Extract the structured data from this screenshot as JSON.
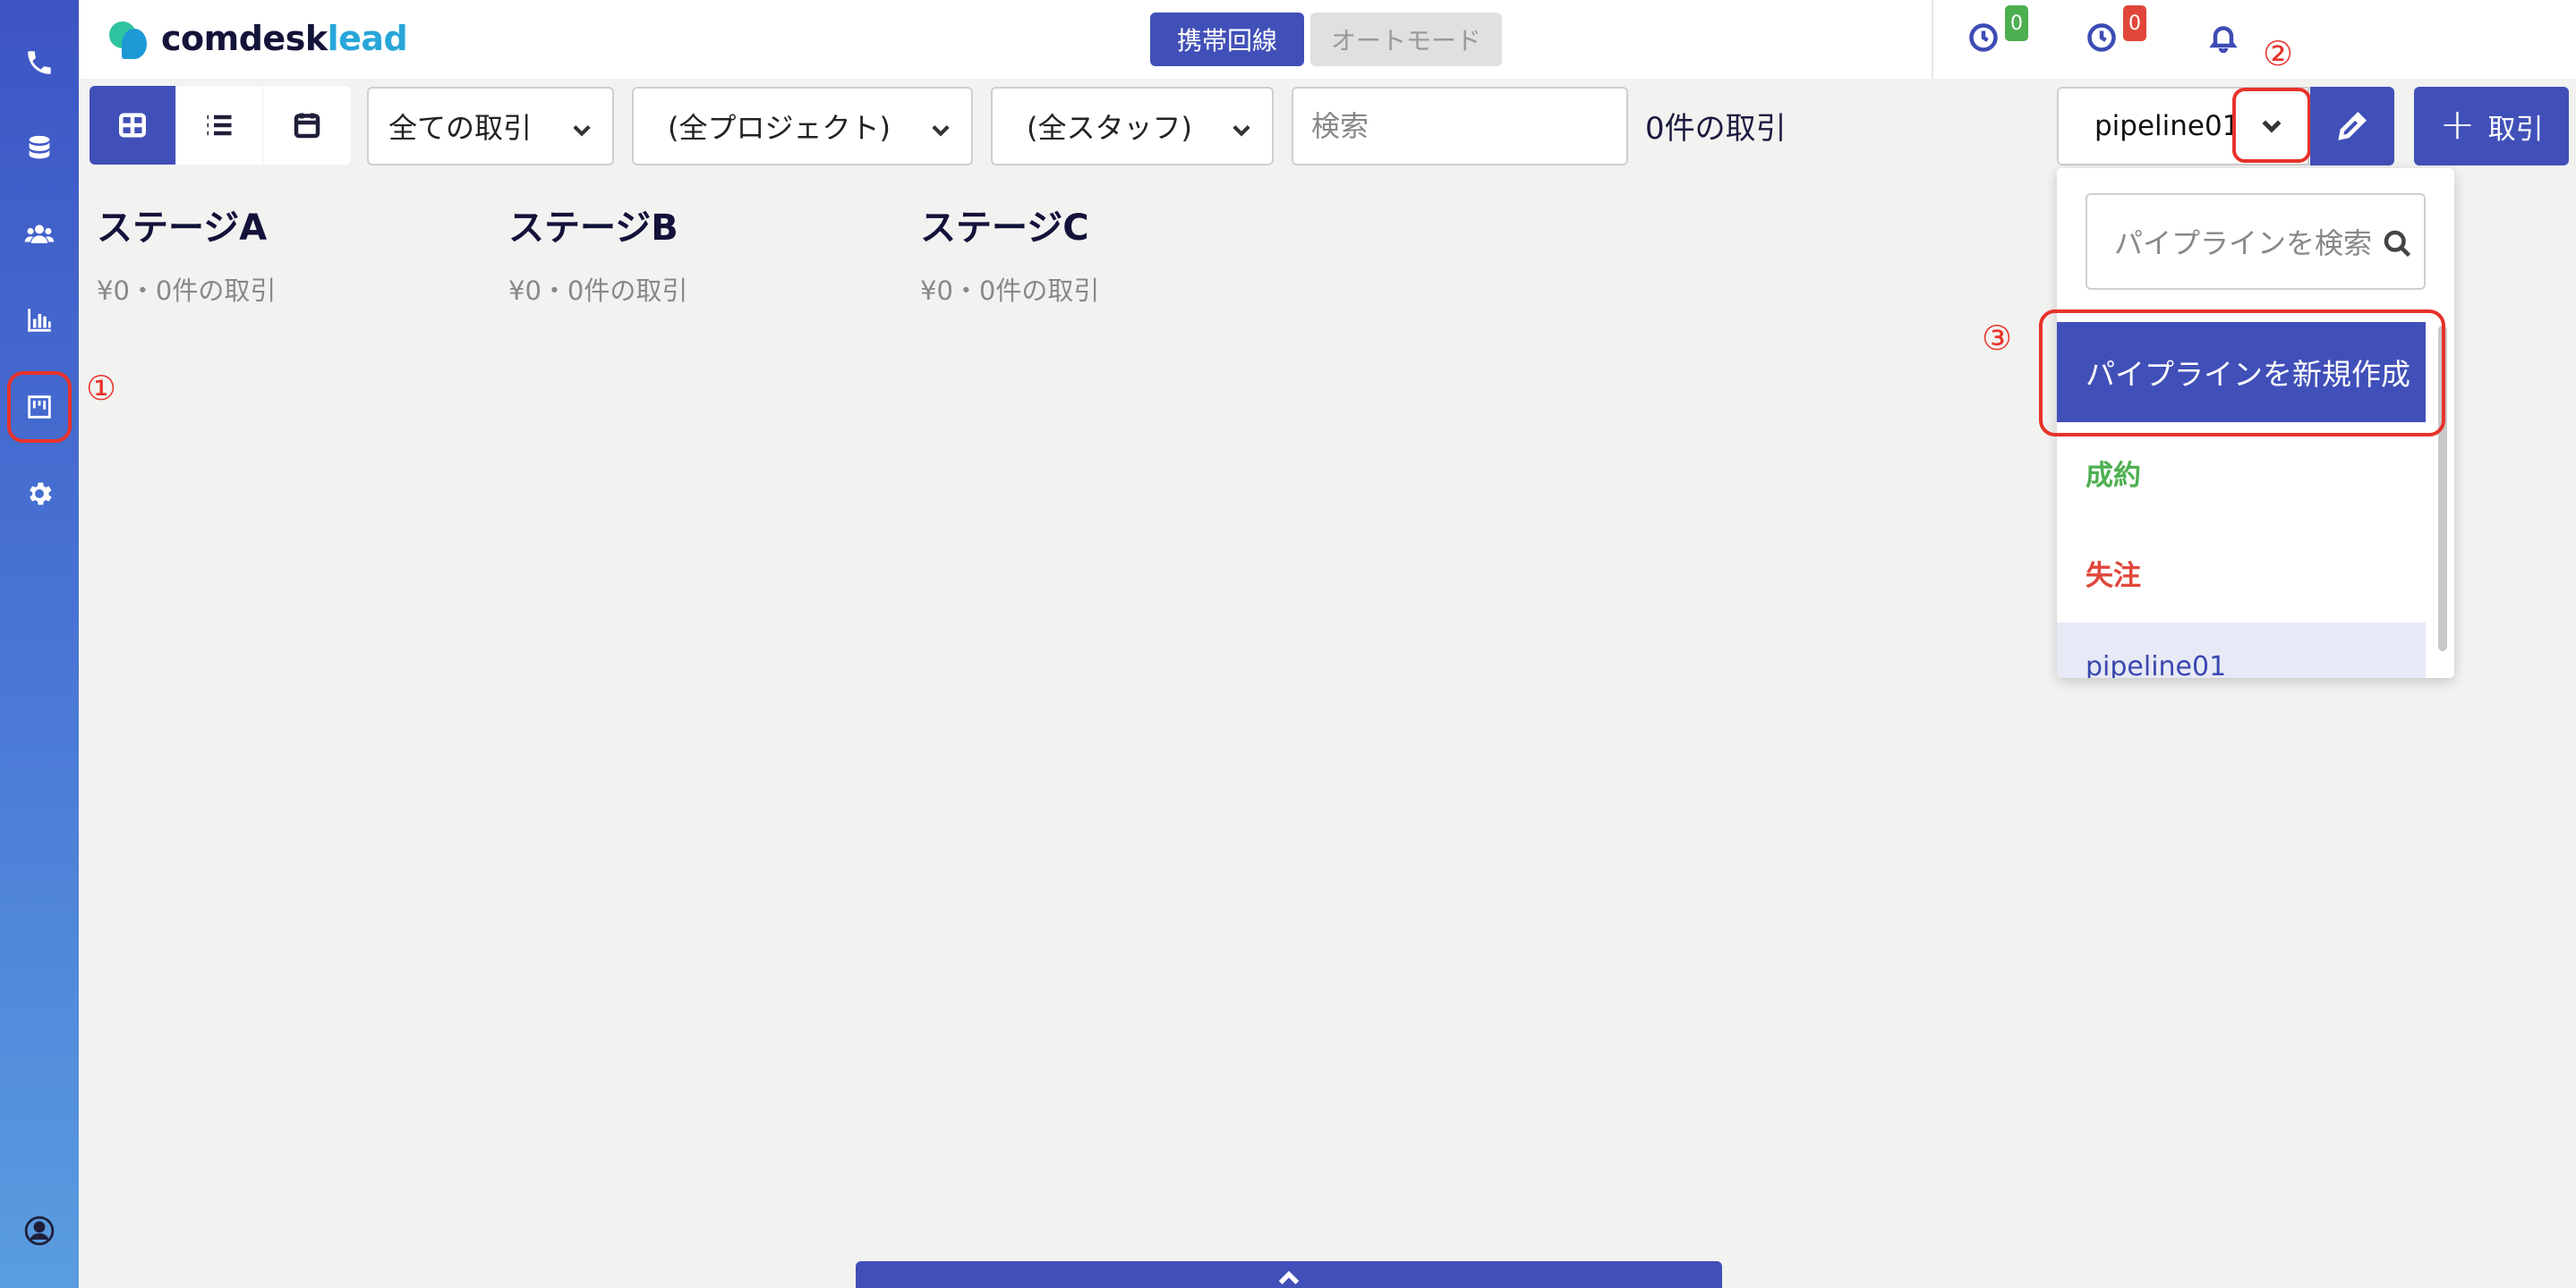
{
  "app": {
    "logo_main": "comdesk",
    "logo_accent": "lead"
  },
  "header": {
    "mode_mobile": "携帯回線",
    "mode_auto": "オートモード",
    "badge_green": "0",
    "badge_red": "0",
    "colors": {
      "green": "#4caf50",
      "red": "#e0463a",
      "primary": "#4150b8"
    }
  },
  "sidebar": {
    "icons": [
      "phone-icon",
      "database-icon",
      "contacts-icon",
      "chart-icon",
      "kanban-icon",
      "gear-icon",
      "user-icon"
    ]
  },
  "toolbar": {
    "filter_deals": "全ての取引",
    "filter_project": "(全プロジェクト)",
    "filter_staff": "(全スタッフ)",
    "search_placeholder": "検索",
    "deal_count": "0件の取引",
    "pipeline_selected": "pipeline01",
    "add_deal_label": "取引"
  },
  "stages": [
    {
      "title": "ステージA",
      "summary": "¥0・0件の取引"
    },
    {
      "title": "ステージB",
      "summary": "¥0・0件の取引"
    },
    {
      "title": "ステージC",
      "summary": "¥0・0件の取引"
    }
  ],
  "annotations": {
    "one": "①",
    "two": "②",
    "three": "③"
  },
  "dropdown": {
    "search_placeholder": "パイプラインを検索",
    "create_new": "パイプラインを新規作成",
    "items": [
      "成約",
      "失注",
      "pipeline01"
    ]
  }
}
